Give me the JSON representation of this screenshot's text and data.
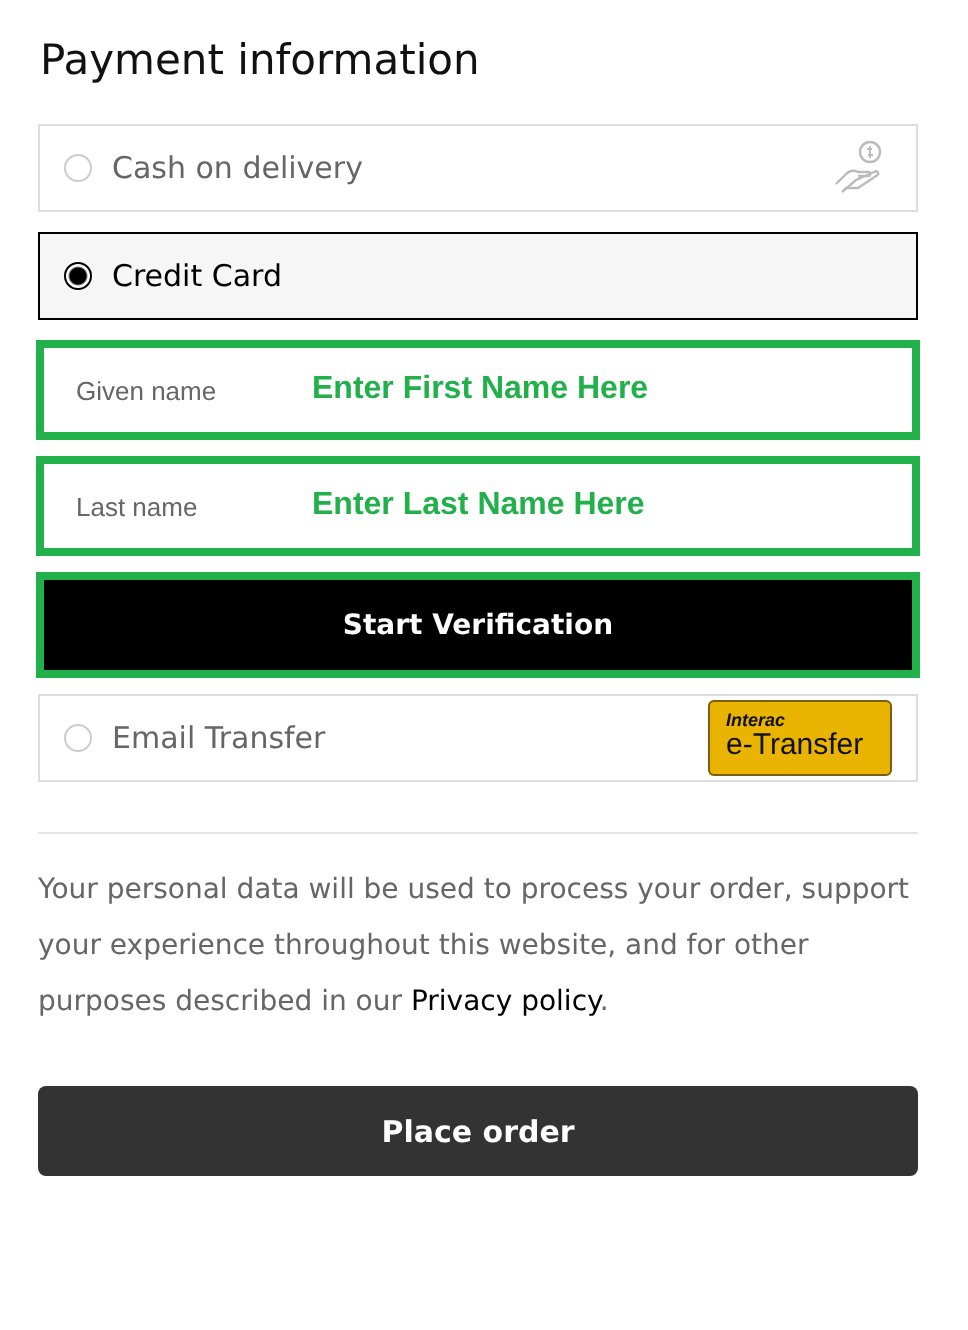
{
  "title": "Payment information",
  "methods": [
    {
      "kind": "cash",
      "label": "Cash on delivery",
      "selected": false
    },
    {
      "kind": "card",
      "label": "Credit Card",
      "selected": true,
      "fields": [
        {
          "label": "Given name",
          "note": "Enter First Name Here"
        },
        {
          "label": "Last name",
          "note": "Enter Last Name Here"
        }
      ],
      "button": "Start Verification"
    },
    {
      "kind": "transfer",
      "label": "Email Transfer",
      "selected": false,
      "logo": {
        "top": "Interac",
        "main": "e-Transfer"
      }
    }
  ],
  "privacy": {
    "before": "Your personal data will be used to process your order, support your experience throughout this website, and for other purposes described in our ",
    "link": "Privacy policy",
    "after": "."
  },
  "place_order": "Place order"
}
